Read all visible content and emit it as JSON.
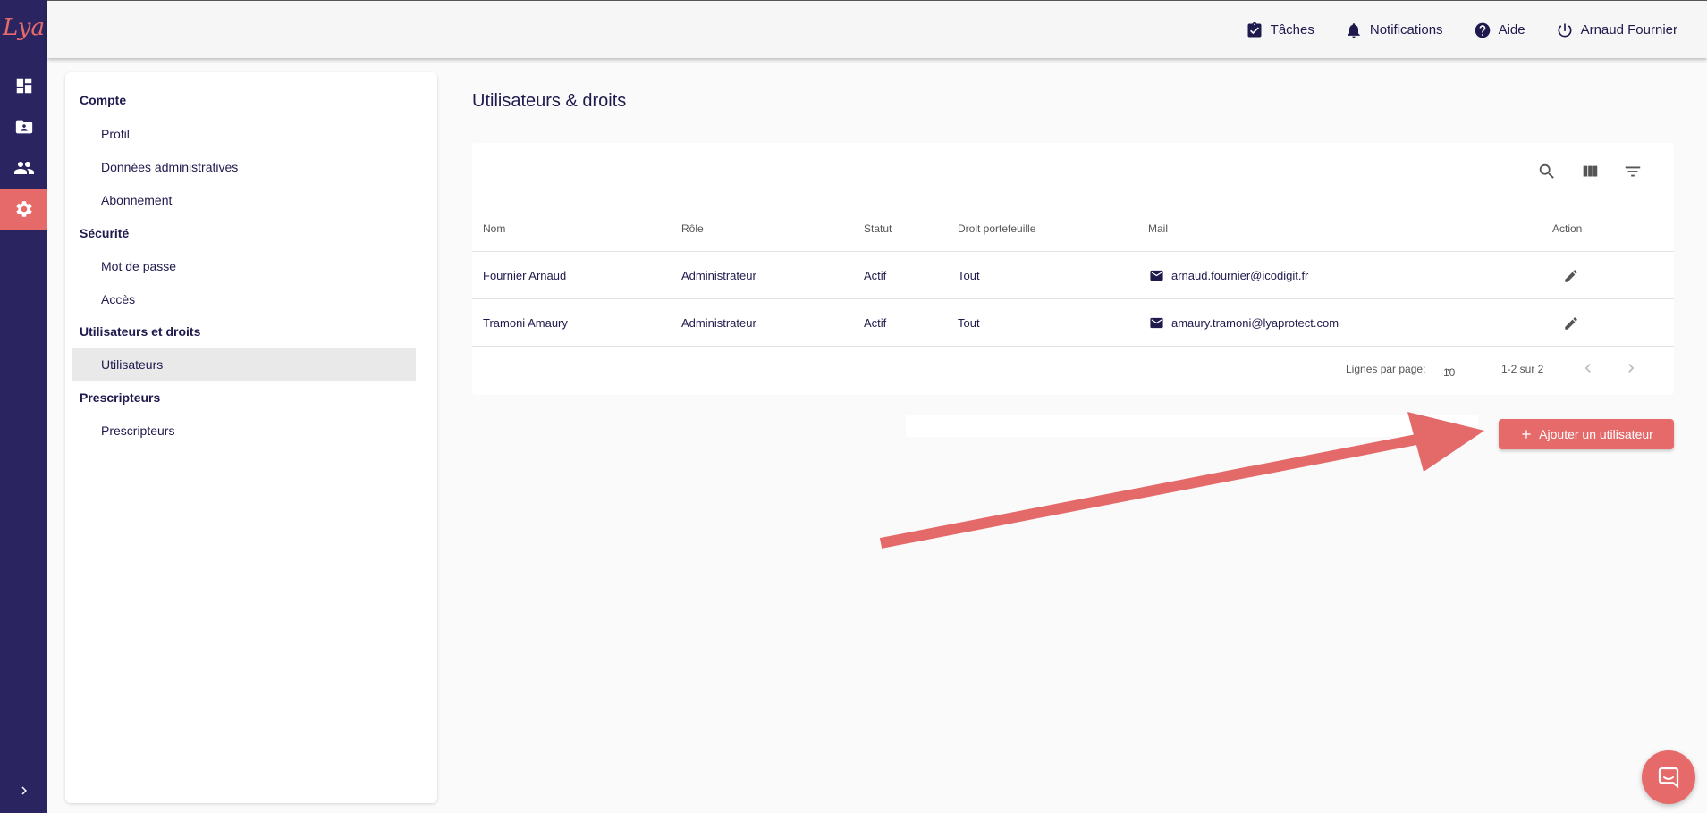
{
  "app": {
    "logo_text": "Lya"
  },
  "rail": {
    "icons": [
      "dashboard-icon",
      "folder-user-icon",
      "people-icon",
      "gear-icon"
    ],
    "active": "gear-icon",
    "expand_icon": "chevron-right-icon"
  },
  "topbar": {
    "tasks_label": "Tâches",
    "notifications_label": "Notifications",
    "help_label": "Aide",
    "user_label": "Arnaud Fournier"
  },
  "sidebar": {
    "sections": [
      {
        "title": "Compte",
        "items": [
          "Profil",
          "Données administratives",
          "Abonnement"
        ]
      },
      {
        "title": "Sécurité",
        "items": [
          "Mot de passe",
          "Accès"
        ]
      },
      {
        "title": "Utilisateurs et droits",
        "items": [
          "Utilisateurs"
        ]
      },
      {
        "title": "Prescripteurs",
        "items": [
          "Prescripteurs"
        ]
      }
    ],
    "active_item": "Utilisateurs"
  },
  "main": {
    "title": "Utilisateurs & droits",
    "table": {
      "columns": [
        "Nom",
        "Rôle",
        "Statut",
        "Droit portefeuille",
        "Mail",
        "Action"
      ],
      "rows": [
        {
          "nom": "Fournier Arnaud",
          "role": "Administrateur",
          "statut": "Actif",
          "droit": "Tout",
          "mail": "arnaud.fournier@icodigit.fr"
        },
        {
          "nom": "Tramoni Amaury",
          "role": "Administrateur",
          "statut": "Actif",
          "droit": "Tout",
          "mail": "amaury.tramoni@lyaprotect.com"
        }
      ]
    },
    "pagination": {
      "rows_per_page_label": "Lignes par page:",
      "rows_per_page_value": "10",
      "range_label": "1-2 sur 2"
    },
    "add_button_label": "Ajouter un utilisateur"
  },
  "colors": {
    "accent": "#e66a6a",
    "navy": "#2a2460",
    "text": "#1f1a4d"
  }
}
